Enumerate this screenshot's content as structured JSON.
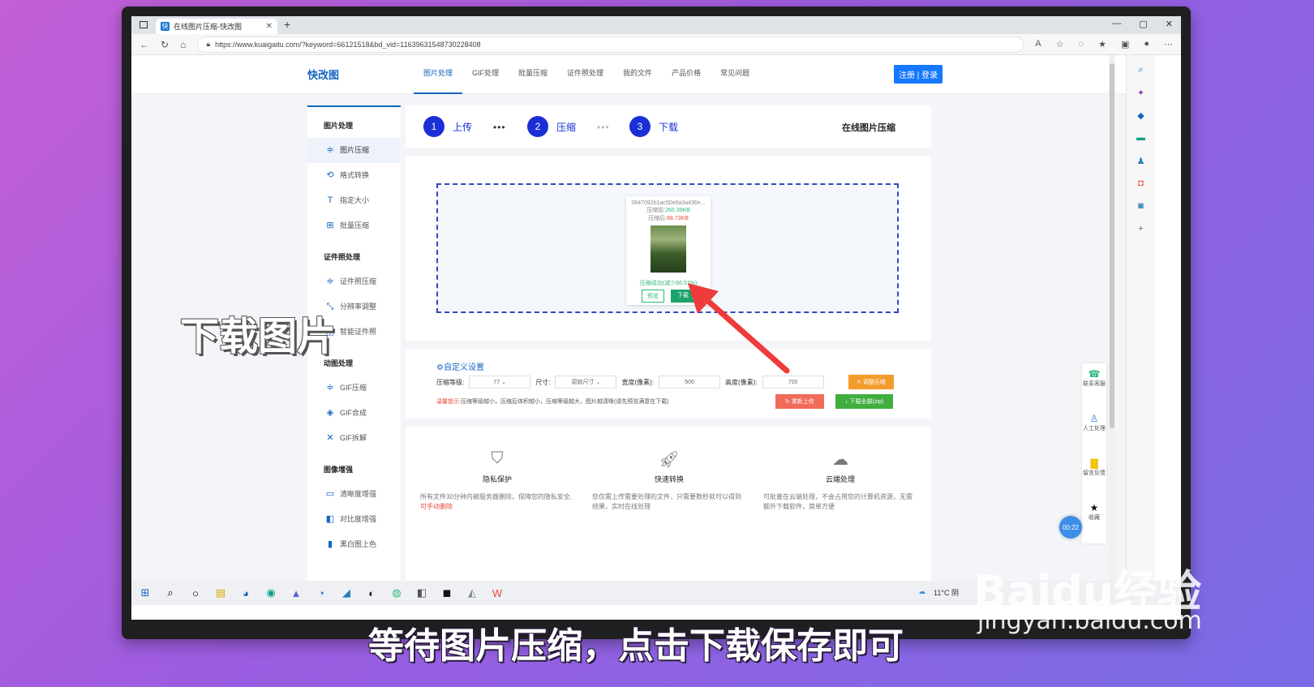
{
  "browser": {
    "tab_title": "在线图片压缩-快改图",
    "tab_favicon": "快",
    "url": "https://www.kuaigaitu.com/?keyword=66121518&bd_vid=11639631548730228408"
  },
  "site": {
    "logo": "快改图",
    "nav": [
      "图片处理",
      "GIF处理",
      "批量压缩",
      "证件照处理",
      "我的文件",
      "产品价格",
      "常见问题"
    ],
    "login": "注册 | 登录"
  },
  "sidebar": {
    "groups": [
      {
        "title": "图片处理",
        "items": [
          {
            "label": "图片压缩",
            "icon": "compress-icon"
          },
          {
            "label": "格式转换",
            "icon": "convert-icon"
          },
          {
            "label": "指定大小",
            "icon": "text-size-icon"
          },
          {
            "label": "批量压缩",
            "icon": "batch-icon"
          }
        ]
      },
      {
        "title": "证件照处理",
        "items": [
          {
            "label": "证件照压缩",
            "icon": "compress-icon"
          },
          {
            "label": "分辨率调整",
            "icon": "resolution-icon"
          },
          {
            "label": "智能证件照",
            "icon": "id-photo-icon"
          }
        ]
      },
      {
        "title": "动图处理",
        "items": [
          {
            "label": "GIF压缩",
            "icon": "compress-icon"
          },
          {
            "label": "GIF合成",
            "icon": "layers-icon"
          },
          {
            "label": "GIF拆解",
            "icon": "split-icon"
          }
        ]
      },
      {
        "title": "图像增强",
        "items": [
          {
            "label": "清晰度增强",
            "icon": "hd-icon"
          },
          {
            "label": "对比度增强",
            "icon": "contrast-icon"
          },
          {
            "label": "黑白图上色",
            "icon": "colorize-icon"
          }
        ]
      }
    ]
  },
  "steps": {
    "items": [
      {
        "num": "1",
        "label": "上传"
      },
      {
        "num": "2",
        "label": "压缩"
      },
      {
        "num": "3",
        "label": "下载"
      }
    ],
    "title": "在线图片压缩"
  },
  "upload": {
    "filename": "0647092b1ac50e6a3a436e...",
    "before_label": "压缩前:",
    "before_value": "265.39KB",
    "after_label": "压缩后:",
    "after_value": "88.73KB",
    "status": "压缩成功(减少66.57%)",
    "preview_btn": "预览",
    "download_btn": "下载"
  },
  "settings": {
    "heading": "自定义设置",
    "level_label": "压缩等级:",
    "level_value": "77",
    "size_label": "尺寸:",
    "size_value": "原始尺寸",
    "width_label": "宽度(像素):",
    "width_value": "500",
    "height_label": "高度(像素):",
    "height_value": "700",
    "adjust_btn": "调整压缩",
    "tip_prefix": "温馨提示:",
    "tip_text": "压缩等级越小，压缩后体积越小，压缩等级越大，图片越清晰(请先预览满意在下载)",
    "reupload_btn": "重新上传",
    "download_all_btn": "下载全部(zip)"
  },
  "features": [
    {
      "title": "隐私保护",
      "desc": "所有文件30分钟内被服务器删除，保障您的隐私安全,",
      "link": "可手动删除"
    },
    {
      "title": "快速转换",
      "desc": "您仅需上传需要处理的文件，只需要数秒就可以得到结果，实时在线处理",
      "link": ""
    },
    {
      "title": "云端处理",
      "desc": "可批量在云端处理，不会占用您的计算机资源，无需额外下载软件，简单方便",
      "link": ""
    }
  ],
  "float": [
    {
      "label": "联系客服",
      "icon": "customer-service-icon"
    },
    {
      "label": "人工处理",
      "icon": "person-icon"
    },
    {
      "label": "留言反馈",
      "icon": "message-icon"
    },
    {
      "label": "收藏",
      "icon": "star-icon"
    }
  ],
  "timer": "00:22",
  "taskbar": {
    "weather": "11°C 阴"
  },
  "overlay": {
    "label": "下载图片",
    "subtitle": "等待图片压缩，点击下载保存即可",
    "watermark": "Baidu经验",
    "watermark_url": "jingyan.baidu.com"
  }
}
